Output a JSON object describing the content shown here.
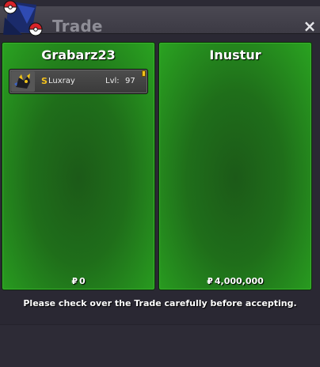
{
  "window": {
    "title": "Trade",
    "close_label": "×"
  },
  "left_panel": {
    "player_name": "Grabarz23",
    "money": "0",
    "currency_symbol": "₽",
    "pokemon": [
      {
        "shiny_symbol": "S",
        "name": "Luxray",
        "level_label": "Lvl:",
        "level": "97",
        "icon": "luxray-sprite-icon",
        "held_item_icon": "held-item-icon"
      }
    ]
  },
  "right_panel": {
    "player_name": "Inustur",
    "money": "4,000,000",
    "currency_symbol": "₽"
  },
  "notice": "Please check over the Trade carefully before accepting.",
  "colors": {
    "panel_green": "#2aa321",
    "panel_dark": "#1c5a18",
    "window_bg": "#2a2833",
    "title_text": "#8e8d96",
    "shiny_gold": "#f4c21c"
  }
}
